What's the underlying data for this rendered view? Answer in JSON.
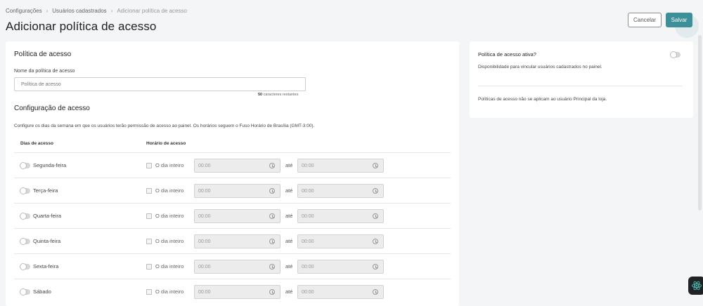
{
  "breadcrumb": [
    "Configurações",
    "Usuários cadastrados",
    "Adicionar política de acesso"
  ],
  "page_title": "Adicionar política de acesso",
  "actions": {
    "cancel_label": "Cancelar",
    "save_label": "Salvar"
  },
  "policy": {
    "section_title": "Política de acesso",
    "name_label": "Nome da política de acesso",
    "name_placeholder": "Política de acesso",
    "counter_bold": "50",
    "counter_text": " caracteres restantes"
  },
  "access_config": {
    "section_title": "Configuração de acesso",
    "description": "Configure os dias da semana em que os usuários terão permissão de acesso ao painel. Os horários seguem o Fuso Horário de Brasília (GMT-3:00).",
    "col_days": "Dias de acesso",
    "col_hours": "Horário de acesso",
    "all_day_label": "O dia inteiro",
    "until_label": "até",
    "rows": [
      {
        "day": "Segunda-feira",
        "enabled": false,
        "all_day": false,
        "start": "00:00",
        "end": "00:00"
      },
      {
        "day": "Terça-feira",
        "enabled": false,
        "all_day": false,
        "start": "00:00",
        "end": "00:00"
      },
      {
        "day": "Quarta-feira",
        "enabled": false,
        "all_day": false,
        "start": "00:00",
        "end": "00:00"
      },
      {
        "day": "Quinta-feira",
        "enabled": false,
        "all_day": false,
        "start": "00:00",
        "end": "00:00"
      },
      {
        "day": "Sexta-feira",
        "enabled": false,
        "all_day": false,
        "start": "00:00",
        "end": "00:00"
      },
      {
        "day": "Sábado",
        "enabled": false,
        "all_day": false,
        "start": "00:00",
        "end": "00:00"
      }
    ]
  },
  "sidebar": {
    "title": "Política de acesso ativa?",
    "active": false,
    "description": "Disponibilidade para vincular usuários cadastrados no painel.",
    "note": "Políticas de acesso não se aplicam ao usuário Principal da loja."
  },
  "colors": {
    "accent": "#3d8f99",
    "background": "#f4f5f6",
    "card": "#ffffff"
  }
}
